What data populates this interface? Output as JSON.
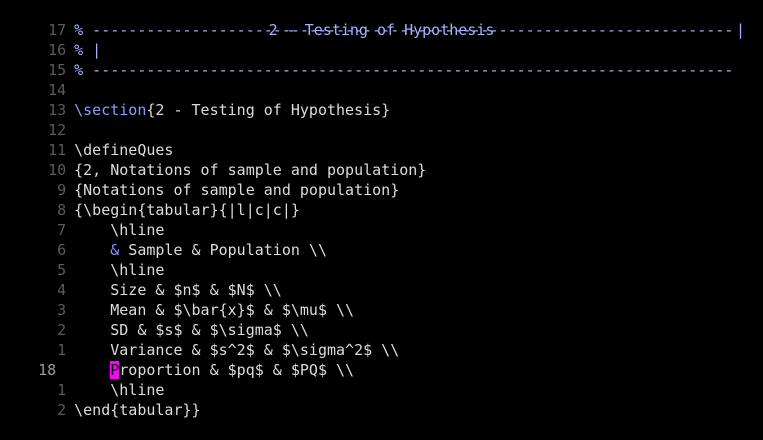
{
  "editor": {
    "lines": [
      {
        "num": "17",
        "text": "% -----------------------------------------------------------------------"
      },
      {
        "num": "16",
        "text": "% |",
        "title": "2 - Testing of Hypothesis",
        "end": "|"
      },
      {
        "num": "15",
        "text": "% -----------------------------------------------------------------------"
      },
      {
        "num": "14",
        "text": ""
      },
      {
        "num": "13",
        "cmd": "\\section",
        "rest": "{2 - Testing of Hypothesis}"
      },
      {
        "num": "12",
        "text": ""
      },
      {
        "num": "11",
        "text": "\\defineQues"
      },
      {
        "num": "10",
        "text": "{2, Notations of sample and population}"
      },
      {
        "num": "9",
        "text": "{Notations of sample and population}"
      },
      {
        "num": "8",
        "text": "{\\begin{tabular}{|l|c|c|}"
      },
      {
        "num": "7",
        "text": "    \\hline"
      },
      {
        "num": "6",
        "amp": "    &",
        "rest": " Sample & Population \\\\"
      },
      {
        "num": "5",
        "text": "    \\hline"
      },
      {
        "num": "4",
        "text": "    Size & $n$ & $N$ \\\\"
      },
      {
        "num": "3",
        "text": "    Mean & $\\bar{x}$ & $\\mu$ \\\\"
      },
      {
        "num": "2",
        "text": "    SD & $s$ & $\\sigma$ \\\\"
      },
      {
        "num": "1",
        "text": "    Variance & $s^2$ & $\\sigma^2$ \\\\"
      },
      {
        "num": "18",
        "cursor": "P",
        "rest": "roportion & $pq$ & $PQ$ \\\\",
        "indent": "    "
      },
      {
        "num": "1",
        "text": "    \\hline"
      },
      {
        "num": "2",
        "text": "\\end{tabular}}"
      }
    ]
  },
  "colors": {
    "background": "#000000",
    "comment": "#9fb4ff",
    "command": "#8a9bff",
    "cursor": "#ff00ff",
    "line_number": "#5a5a5a"
  }
}
